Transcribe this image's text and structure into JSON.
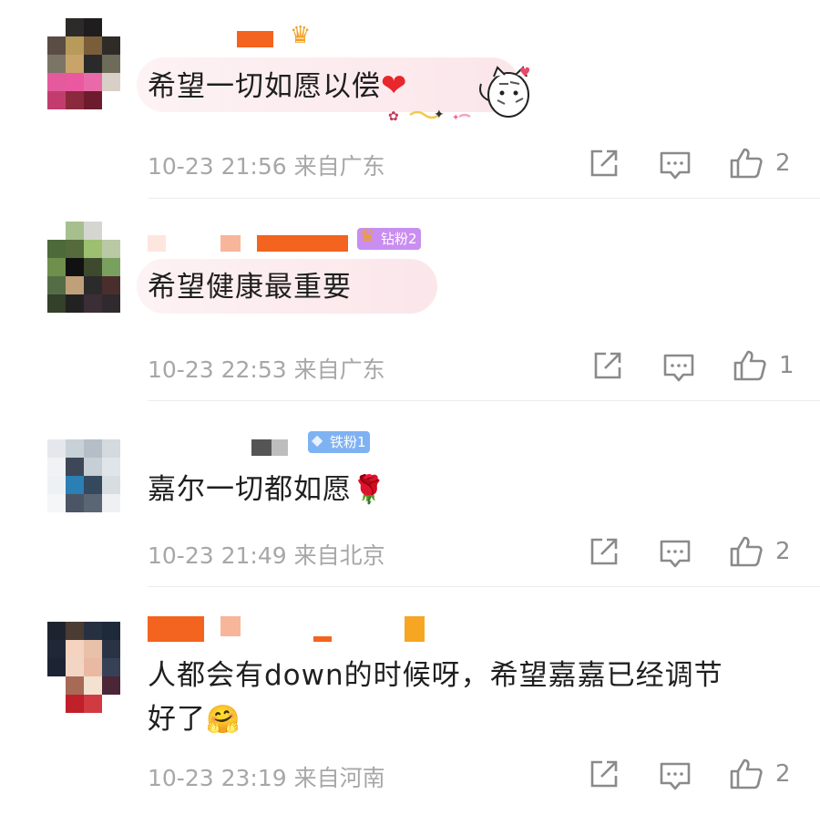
{
  "comments": [
    {
      "text": "希望一切如愿以偿",
      "emoji": "❤",
      "meta": "10-23 21:56 来自广东",
      "likes": "2",
      "badge": ""
    },
    {
      "text": "希望健康最重要",
      "emoji": "",
      "meta": "10-23 22:53 来自广东",
      "likes": "1",
      "badge": "钻粉2"
    },
    {
      "text": "嘉尔一切都如愿",
      "emoji": "🌹",
      "meta": "10-23 21:49 来自北京",
      "likes": "2",
      "badge": "铁粉1"
    },
    {
      "text_line1": "人都会有down的时候呀，希望嘉嘉已经调节",
      "text_line2": "好了",
      "emoji": "🤗",
      "meta": "10-23 23:19 来自河南",
      "likes": "2"
    }
  ],
  "icons": {
    "share": "share-icon",
    "comment": "comment-icon",
    "like": "like-icon"
  },
  "colors": {
    "meta_gray": "#a7a7a7",
    "diamond_badge": "#c98ef0",
    "iron_badge": "#7fb2f3",
    "name_orange": "#f2641f"
  }
}
